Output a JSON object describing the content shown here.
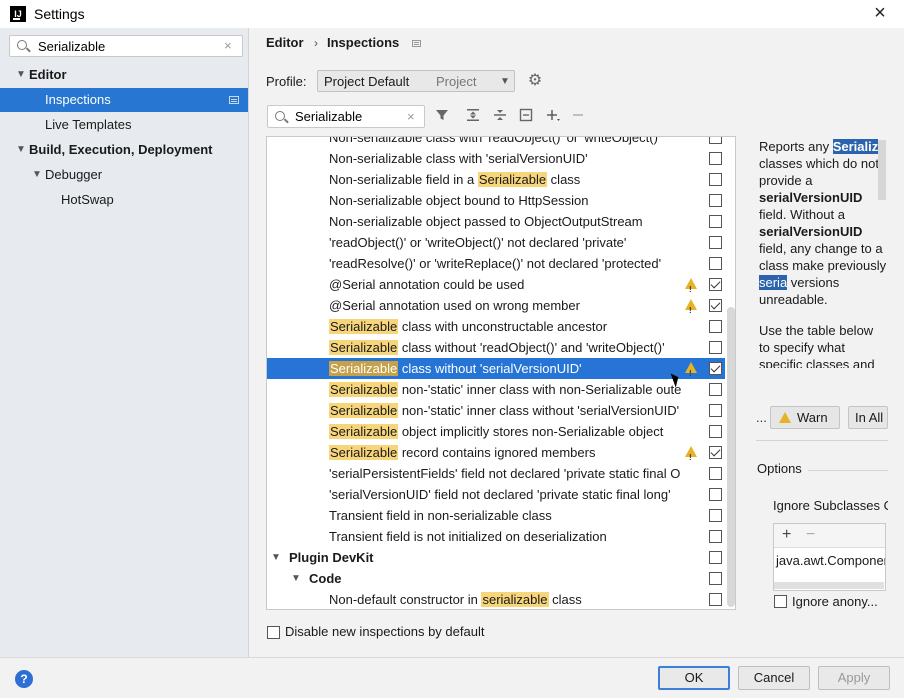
{
  "window": {
    "title": "Settings",
    "app_icon": "intellij-logo-icon",
    "close_icon": "close-icon"
  },
  "left": {
    "search_value": "Serializable",
    "tree": [
      {
        "label": "Editor",
        "bold": true,
        "expanded": true
      },
      {
        "label": "Inspections",
        "selected": true
      },
      {
        "label": "Live Templates"
      },
      {
        "label": "Build, Execution, Deployment",
        "bold": true,
        "expanded": true
      },
      {
        "label": "Debugger",
        "expanded": true
      },
      {
        "label": "HotSwap"
      }
    ]
  },
  "breadcrumb": {
    "root": "Editor",
    "separator": "›",
    "current": "Inspections"
  },
  "profile": {
    "label": "Profile:",
    "name": "Project Default",
    "scope": "Project"
  },
  "inspections": {
    "search_value": "Serializable",
    "toolbar_icons": [
      "filter-icon",
      "expand-all-icon",
      "collapse-all-icon",
      "reset-icon",
      "add-icon",
      "remove-icon"
    ],
    "rows": [
      {
        "pre": "Non-serializable class with 'readObject()' or 'writeObject()'",
        "hl": "",
        "post": "",
        "checked": false,
        "warn": false
      },
      {
        "pre": "Non-serializable class with 'serialVersionUID'",
        "hl": "",
        "post": "",
        "checked": false,
        "warn": false
      },
      {
        "pre": "Non-serializable field in a ",
        "hl": "Serializable",
        "post": " class",
        "checked": false,
        "warn": false
      },
      {
        "pre": "Non-serializable object bound to HttpSession",
        "hl": "",
        "post": "",
        "checked": false,
        "warn": false
      },
      {
        "pre": "Non-serializable object passed to ObjectOutputStream",
        "hl": "",
        "post": "",
        "checked": false,
        "warn": false
      },
      {
        "pre": "'readObject()' or 'writeObject()' not declared 'private'",
        "hl": "",
        "post": "",
        "checked": false,
        "warn": false
      },
      {
        "pre": "'readResolve()' or 'writeReplace()' not declared 'protected'",
        "hl": "",
        "post": "",
        "checked": false,
        "warn": false
      },
      {
        "pre": "@Serial annotation could be used",
        "hl": "",
        "post": "",
        "checked": true,
        "warn": true
      },
      {
        "pre": "@Serial annotation used on wrong member",
        "hl": "",
        "post": "",
        "checked": true,
        "warn": true
      },
      {
        "pre": "",
        "hl": "Serializable",
        "post": " class with unconstructable ancestor",
        "checked": false,
        "warn": false
      },
      {
        "pre": "",
        "hl": "Serializable",
        "post": " class without 'readObject()' and 'writeObject()'",
        "checked": false,
        "warn": false
      },
      {
        "pre": "",
        "hl": "Serializable",
        "post": " class without 'serialVersionUID'",
        "checked": true,
        "warn": true,
        "selected": true
      },
      {
        "pre": "",
        "hl": "Serializable",
        "post": " non-'static' inner class with non-Serializable oute",
        "checked": false,
        "warn": false
      },
      {
        "pre": "",
        "hl": "Serializable",
        "post": " non-'static' inner class without 'serialVersionUID'",
        "checked": false,
        "warn": false
      },
      {
        "pre": "",
        "hl": "Serializable",
        "post": " object implicitly stores non-Serializable object",
        "checked": false,
        "warn": false
      },
      {
        "pre": "",
        "hl": "Serializable",
        "post": " record contains ignored members",
        "checked": true,
        "warn": true
      },
      {
        "pre": "'serialPersistentFields' field not declared 'private static final O",
        "hl": "",
        "post": "",
        "checked": false,
        "warn": false
      },
      {
        "pre": "'serialVersionUID' field not declared 'private static final long'",
        "hl": "",
        "post": "",
        "checked": false,
        "warn": false
      },
      {
        "pre": "Transient field in non-serializable class",
        "hl": "",
        "post": "",
        "checked": false,
        "warn": false
      },
      {
        "pre": "Transient field is not initialized on deserialization",
        "hl": "",
        "post": "",
        "checked": false,
        "warn": false
      },
      {
        "pre": "Plugin DevKit",
        "hl": "",
        "post": "",
        "checked": false,
        "warn": false,
        "group": 1
      },
      {
        "pre": "Code",
        "hl": "",
        "post": "",
        "checked": false,
        "warn": false,
        "group": 2
      },
      {
        "pre": "Non-default constructor in ",
        "hl": "serializable",
        "post": " class",
        "checked": false,
        "warn": false
      }
    ]
  },
  "description": {
    "p1_a": "Reports any ",
    "p1_hl": "Serializ",
    "p1_b": " classes which do not provide a ",
    "p1_bold1": "serialVersionUID",
    "p1_c": " field. Without a ",
    "p1_bold2": "serialVersionUID",
    "p1_d": " field, any change to a class make previously ",
    "p1_hl2": "seria",
    "p1_e": " versions unreadable.",
    "p2": "Use the table below to specify what specific classes and inheritors should be"
  },
  "severity": {
    "ellipsis": "...",
    "label": "Warn",
    "scope": "In All"
  },
  "options": {
    "title": "Options",
    "ignore_subclasses": "Ignore Subclasses O",
    "sub_item": "java.awt.Componen",
    "add": "+",
    "remove": "−",
    "ignore_anonymous": "Ignore anony..."
  },
  "disable_new": "Disable new inspections by default",
  "buttons": {
    "help": "?",
    "ok": "OK",
    "cancel": "Cancel",
    "apply": "Apply"
  }
}
